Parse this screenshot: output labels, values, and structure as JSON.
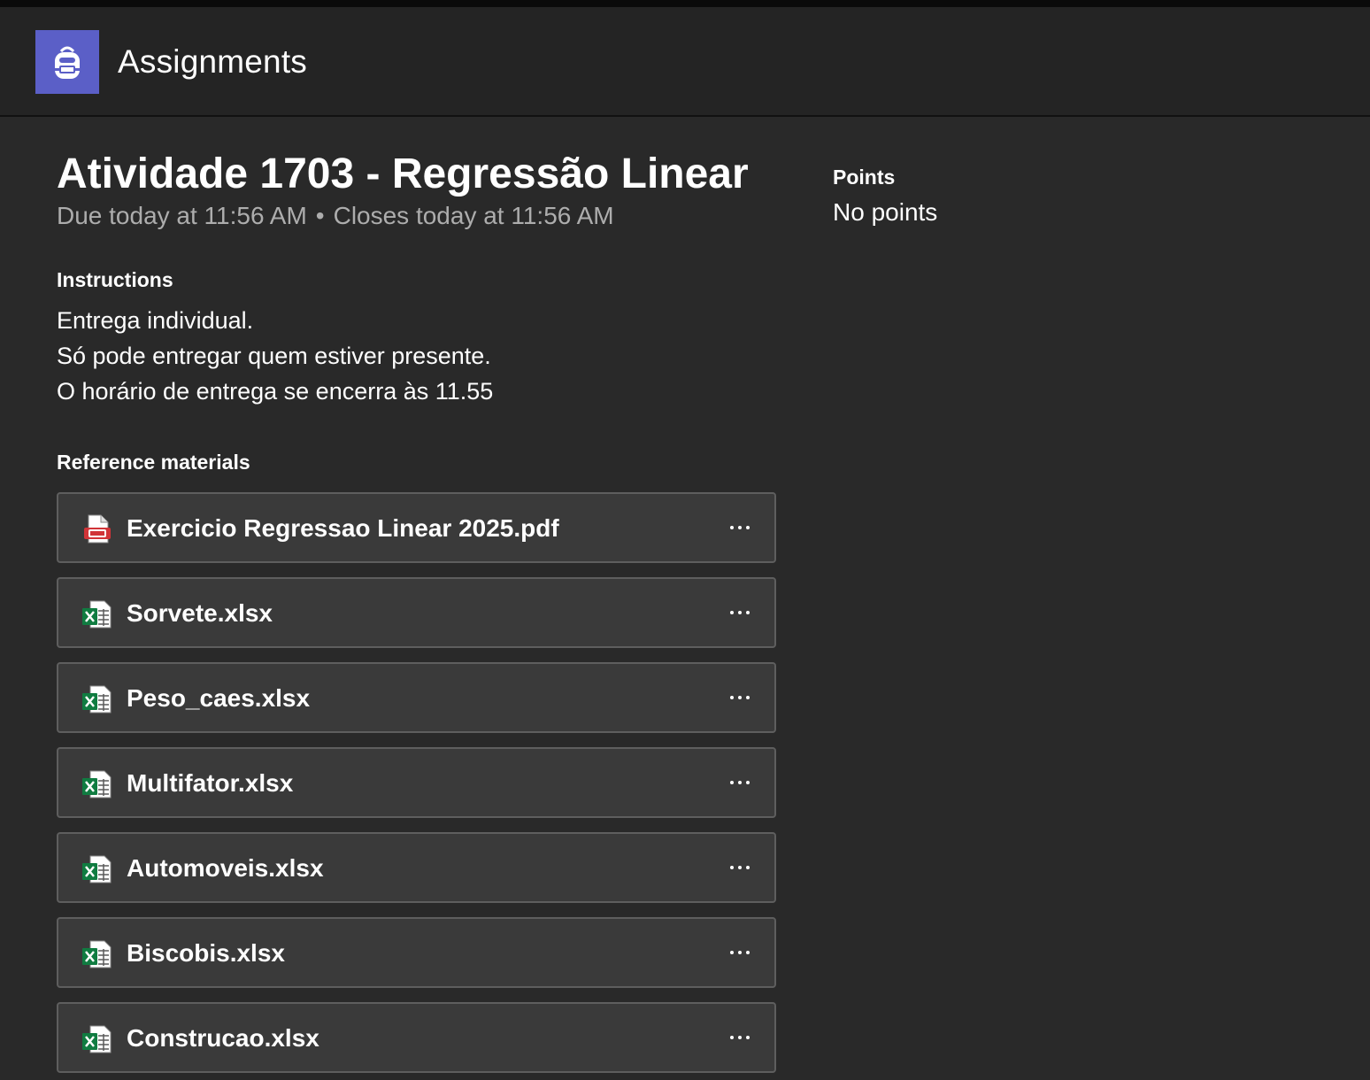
{
  "app": {
    "title": "Assignments",
    "icon": "backpack-icon",
    "accent_color": "#5b5fc7"
  },
  "assignment": {
    "title": "Atividade 1703 - Regressão Linear",
    "due": "Due today at 11:56 AM",
    "separator": "•",
    "closes": "Closes today at 11:56 AM"
  },
  "points": {
    "label": "Points",
    "value": "No points"
  },
  "instructions": {
    "label": "Instructions",
    "lines": [
      "Entrega individual.",
      "Só pode entregar quem estiver presente.",
      "O horário de entrega se encerra às 11.55"
    ]
  },
  "reference": {
    "label": "Reference materials",
    "files": [
      {
        "name": "Exercicio Regressao Linear 2025.pdf",
        "icon": "pdf-file-icon"
      },
      {
        "name": "Sorvete.xlsx",
        "icon": "excel-file-icon"
      },
      {
        "name": "Peso_caes.xlsx",
        "icon": "excel-file-icon"
      },
      {
        "name": "Multifator.xlsx",
        "icon": "excel-file-icon"
      },
      {
        "name": "Automoveis.xlsx",
        "icon": "excel-file-icon"
      },
      {
        "name": "Biscobis.xlsx",
        "icon": "excel-file-icon"
      },
      {
        "name": "Construcao.xlsx",
        "icon": "excel-file-icon"
      }
    ]
  }
}
